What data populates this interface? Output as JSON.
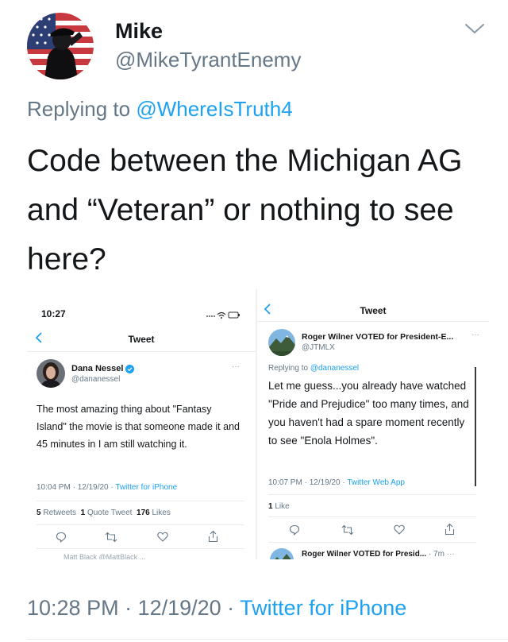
{
  "author": {
    "name": "Mike",
    "handle": "@MikeTyrantEnemy",
    "avatar_icon": "saluting-soldier-flag-avatar"
  },
  "reply": {
    "prefix": "Replying to",
    "to": "@WhereIsTruth4"
  },
  "tweet": {
    "text": "Code between the Michigan AG and “Veteran” or nothing to see here?"
  },
  "screenshot": {
    "left": {
      "time": "10:27",
      "header": "Tweet",
      "author_name": "Dana Nessel",
      "author_handle": "@dananessel",
      "text": "The most amazing thing about \"Fantasy Island\" the movie is that someone made it and 45 minutes in I am still watching it.",
      "timestamp": "10:04 PM · 12/19/20 · ",
      "source": "Twitter for iPhone",
      "retweets_count": "5",
      "retweets_label": "Retweets",
      "quote_count": "1",
      "quote_label": "Quote Tweet",
      "likes_count": "176",
      "likes_label": "Likes",
      "cut_text": "Matt Black @MattBlack ..."
    },
    "right": {
      "header": "Tweet",
      "author_name": "Roger Wilner VOTED for President-E...",
      "author_handle": "@JTMLX",
      "replying": "Replying to",
      "replying_to": "@dananessel",
      "text": "Let me guess...you already have watched \"Pride and Prejudice\" too many times, and you haven't had a spare moment recently to see \"Enola Holmes\".",
      "timestamp": "10:07 PM · 12/19/20 · ",
      "source": "Twitter Web App",
      "likes_count": "1",
      "likes_label": "Like",
      "next_author": "Roger Wilner VOTED for Presid...",
      "next_time": "· 7m"
    }
  },
  "footer": {
    "timestamp": "10:28 PM · 12/19/20 · ",
    "source": "Twitter for iPhone"
  },
  "colors": {
    "link": "#1da1f2",
    "secondary": "#657786",
    "text": "#14171a"
  }
}
